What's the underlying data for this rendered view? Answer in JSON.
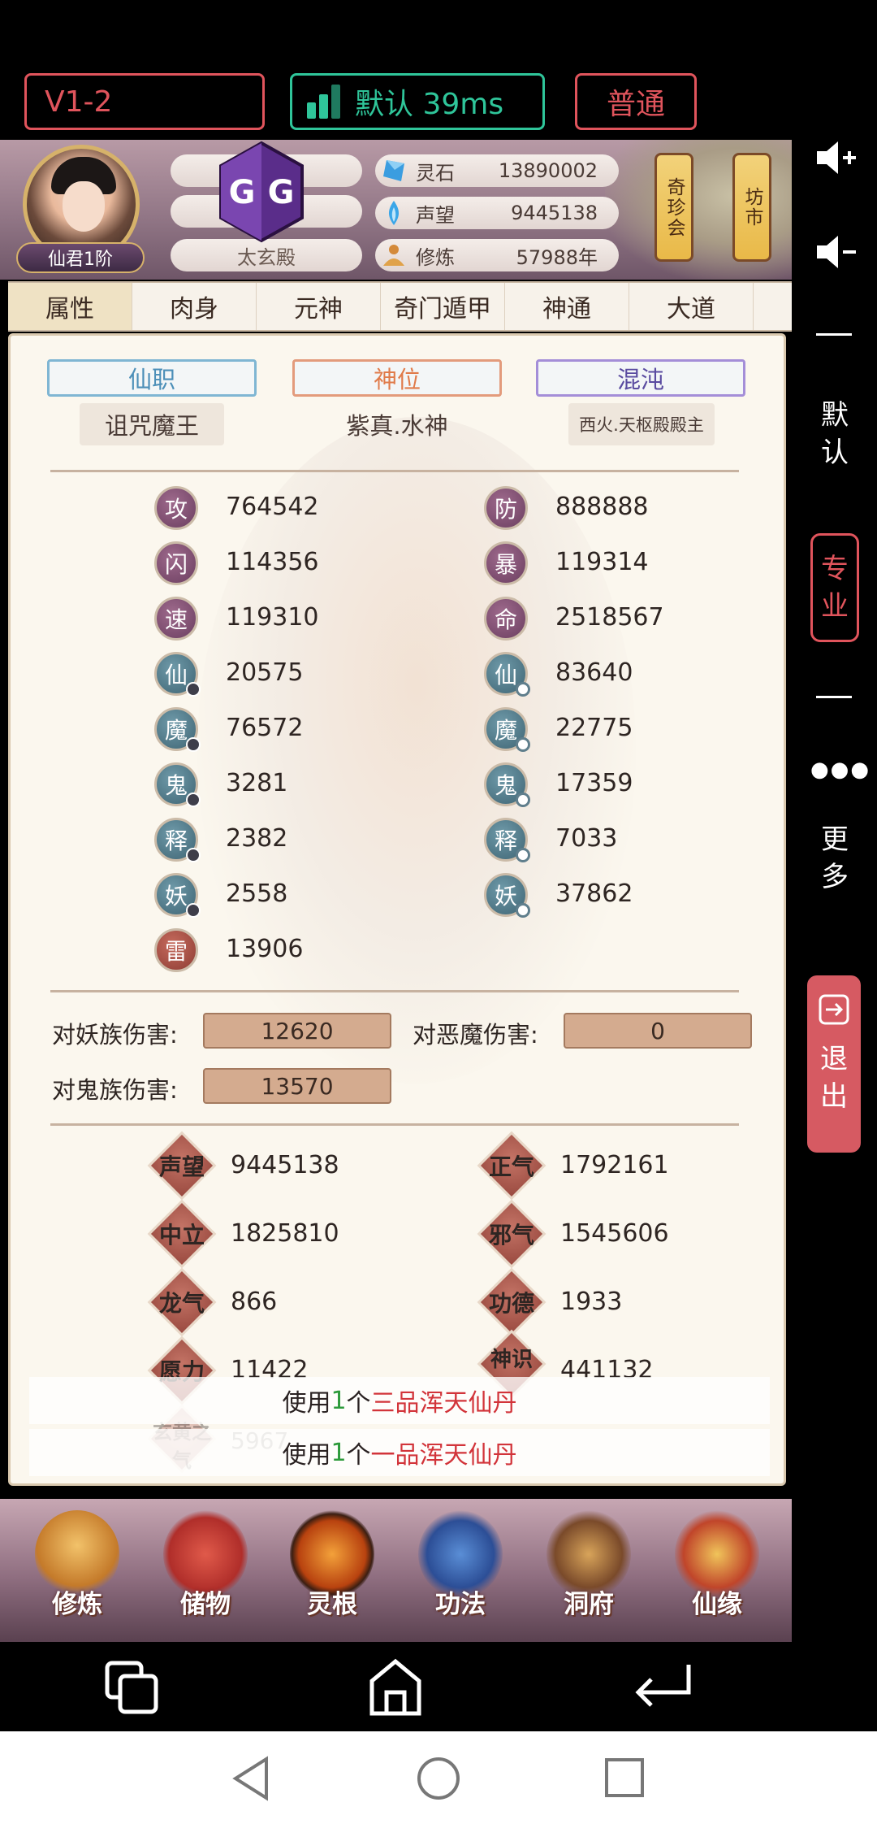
{
  "toolbar": {
    "version": "V1-2",
    "ping": "默认 39ms",
    "mode": "普通"
  },
  "header": {
    "rank": "仙君1阶",
    "palace": "太玄殿",
    "resources": [
      {
        "icon": "spirit-stone-icon",
        "label": "灵石",
        "value": "13890002"
      },
      {
        "icon": "reputation-icon",
        "label": "声望",
        "value": "9445138"
      },
      {
        "icon": "cultivation-icon",
        "label": "修炼",
        "value": "57988年"
      }
    ],
    "lanterns": [
      "奇珍会",
      "坊市"
    ]
  },
  "tabs": [
    "属性",
    "肉身",
    "元神",
    "奇门遁甲",
    "神通",
    "大道"
  ],
  "titles": [
    {
      "tag": "仙职",
      "value": "诅咒魔王"
    },
    {
      "tag": "神位",
      "value": "紫真.水神"
    },
    {
      "tag": "混沌",
      "value": "西火.天枢殿殿主"
    }
  ],
  "stats_left": [
    {
      "icon": "攻",
      "value": "764542"
    },
    {
      "icon": "闪",
      "value": "114356"
    },
    {
      "icon": "速",
      "value": "119310"
    },
    {
      "icon": "仙",
      "value": "20575"
    },
    {
      "icon": "魔",
      "value": "76572"
    },
    {
      "icon": "鬼",
      "value": "3281"
    },
    {
      "icon": "释",
      "value": "2382"
    },
    {
      "icon": "妖",
      "value": "2558"
    },
    {
      "icon": "雷",
      "value": "13906"
    }
  ],
  "stats_right": [
    {
      "icon": "防",
      "value": "888888"
    },
    {
      "icon": "暴",
      "value": "119314"
    },
    {
      "icon": "命",
      "value": "2518567"
    },
    {
      "icon": "仙",
      "value": "83640"
    },
    {
      "icon": "魔",
      "value": "22775"
    },
    {
      "icon": "鬼",
      "value": "17359"
    },
    {
      "icon": "释",
      "value": "7033"
    },
    {
      "icon": "妖",
      "value": "37862"
    }
  ],
  "damage": {
    "yao_label": "对妖族伤害:",
    "yao_value": "12620",
    "demon_label": "对恶魔伤害:",
    "demon_value": "0",
    "ghost_label": "对鬼族伤害:",
    "ghost_value": "13570"
  },
  "reputation": [
    {
      "label": "声望",
      "value": "9445138"
    },
    {
      "label": "正气",
      "value": "1792161"
    },
    {
      "label": "中立",
      "value": "1825810"
    },
    {
      "label": "邪气",
      "value": "1545606"
    },
    {
      "label": "龙气",
      "value": "866"
    },
    {
      "label": "功德",
      "value": "1933"
    },
    {
      "label": "愿力",
      "value": "11422"
    },
    {
      "label": "神识",
      "value": "441132"
    },
    {
      "label": "玄黄之气",
      "value": "5967"
    }
  ],
  "toasts": [
    {
      "prefix": "使用",
      "count": "1",
      "unit": "个",
      "item": "三品浑天仙丹"
    },
    {
      "prefix": "使用",
      "count": "1",
      "unit": "个",
      "item": "一品浑天仙丹"
    }
  ],
  "gamenav": [
    "修炼",
    "储物",
    "灵根",
    "功法",
    "洞府",
    "仙缘"
  ],
  "side": {
    "default": "默认",
    "pro": "专业",
    "more": "更多",
    "exit": "退出"
  },
  "colors": {
    "accent_red": "#e0545c",
    "accent_green": "#2fc59a"
  }
}
